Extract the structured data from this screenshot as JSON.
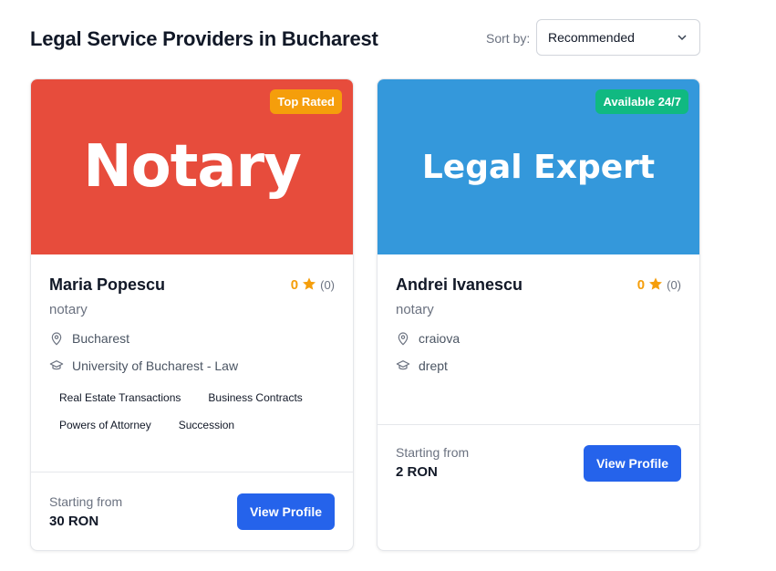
{
  "header": {
    "title": "Legal Service Providers in Bucharest",
    "sort_label": "Sort by:",
    "sort_value": "Recommended"
  },
  "colors": {
    "notary_banner": "#e74c3c",
    "legal_banner": "#3498db",
    "top_rated_badge": "#f59e0b",
    "available_badge": "#10b981",
    "primary_button": "#2563eb",
    "star": "#f59e0b"
  },
  "providers": [
    {
      "banner_text": "Notary",
      "badge": "Top Rated",
      "name": "Maria Popescu",
      "rating": "0",
      "reviews": "(0)",
      "category": "notary",
      "location": "Bucharest",
      "education": "University of Bucharest - Law",
      "tags": [
        "Real Estate Transactions",
        "Business Contracts",
        "Powers of Attorney",
        "Succession"
      ],
      "price_label": "Starting from",
      "price": "30 RON",
      "button": "View Profile"
    },
    {
      "banner_text": "Legal Expert",
      "badge": "Available 24/7",
      "name": "Andrei Ivanescu",
      "rating": "0",
      "reviews": "(0)",
      "category": "notary",
      "location": "craiova",
      "education": "drept",
      "tags": [],
      "price_label": "Starting from",
      "price": "2 RON",
      "button": "View Profile"
    }
  ],
  "icons": {
    "location": "map-pin-icon",
    "education": "graduation-cap-icon",
    "star": "star-icon",
    "chevron": "chevron-down-icon"
  }
}
